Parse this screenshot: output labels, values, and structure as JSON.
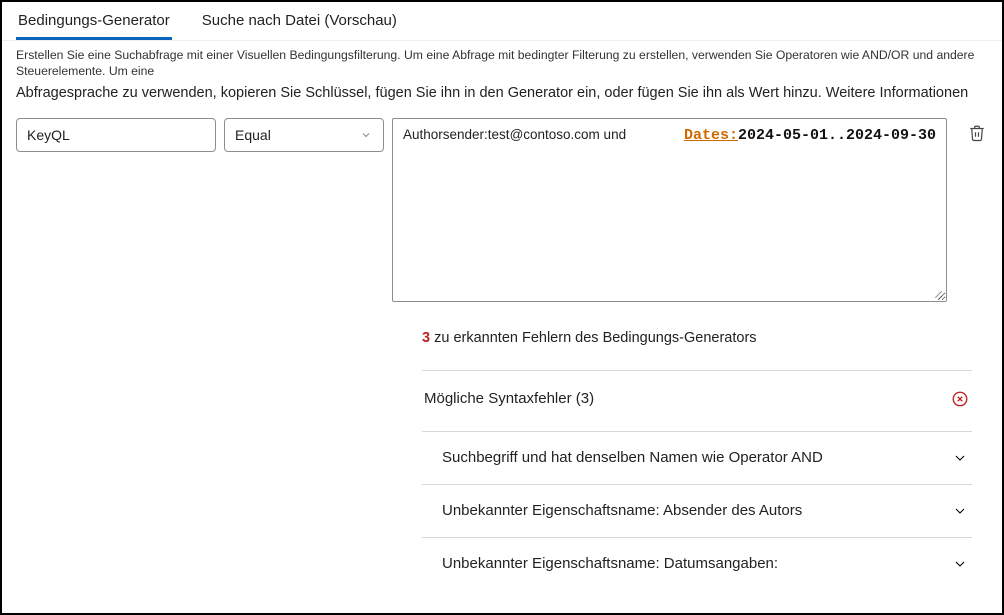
{
  "tabs": {
    "condition_generator": "Bedingungs-Generator",
    "file_search": "Suche nach Datei (Vorschau)"
  },
  "description": {
    "line1": "Erstellen Sie eine Suchabfrage mit einer Visuellen Bedingungsfilterung. Um eine Abfrage mit bedingter Filterung zu erstellen, verwenden Sie Operatoren wie AND/OR und andere Steuerelemente. Um eine",
    "line2": "Abfragesprache zu verwenden, kopieren Sie Schlüssel, fügen Sie ihn in den Generator ein, oder fügen Sie ihn als Wert hinzu. Weitere Informationen"
  },
  "builder": {
    "property_type": "KeyQL",
    "operator": "Equal",
    "query_prefix": "Authorsender:test@contoso.com und",
    "query_dates_key": "Dates:",
    "query_dates_value": "2024-05-01..2024-09-30"
  },
  "errors": {
    "count": "3",
    "summary_suffix": " zu erkannten Fehlern des Bedingungs-Generators",
    "section_title": "Mögliche Syntaxfehler (3)",
    "items": [
      "Suchbegriff und hat denselben Namen wie Operator AND",
      "Unbekannter Eigenschaftsname: Absender des Autors",
      "Unbekannter Eigenschaftsname: Datumsangaben:"
    ]
  }
}
